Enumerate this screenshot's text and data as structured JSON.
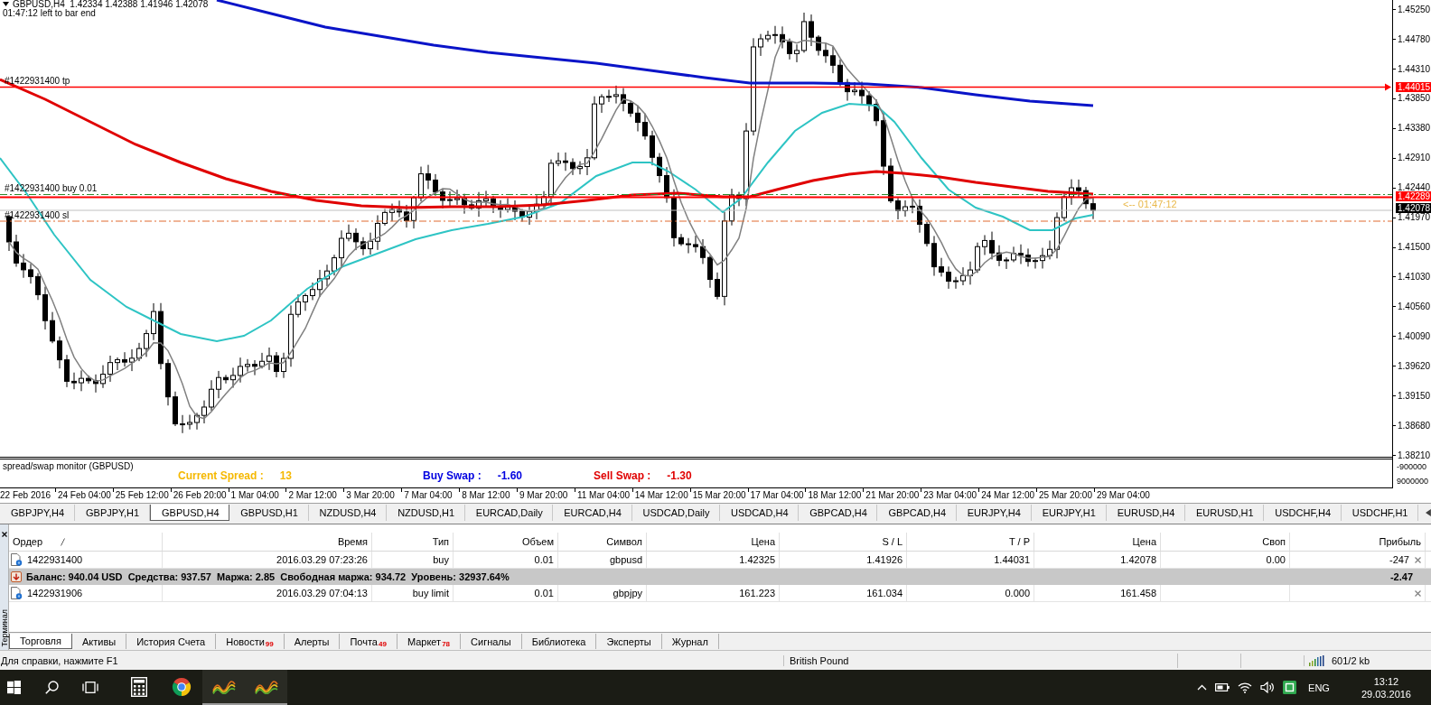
{
  "chart": {
    "info": "GBPUSD,H4  1.42334 1.42388 1.41946 1.42078",
    "timer": "01:47:12 left to bar end",
    "countdown": "<-- 01:47:12",
    "lines": [
      {
        "kind": "tp",
        "label": "#1422931400 tp",
        "price": "1.44015"
      },
      {
        "kind": "level",
        "price": "1.42289"
      },
      {
        "kind": "open",
        "label": "#1422931400 buy 0.01"
      },
      {
        "kind": "bid",
        "price": "1.42078"
      },
      {
        "kind": "sl",
        "label": "#1422931400 sl"
      }
    ],
    "price_axis": [
      "1.45250",
      "1.44780",
      "1.44310",
      "1.43850",
      "1.43380",
      "1.42910",
      "1.42440",
      "1.41970",
      "1.41500",
      "1.41030",
      "1.40560",
      "1.40090",
      "1.39620",
      "1.39150",
      "1.38680",
      "1.38210"
    ],
    "time_axis": [
      "22 Feb 2016",
      "24 Feb 04:00",
      "25 Feb 12:00",
      "26 Feb 20:00",
      "1 Mar 04:00",
      "2 Mar 12:00",
      "3 Mar 20:00",
      "7 Mar 04:00",
      "8 Mar 12:00",
      "9 Mar 20:00",
      "11 Mar 04:00",
      "14 Mar 12:00",
      "15 Mar 20:00",
      "17 Mar 04:00",
      "18 Mar 12:00",
      "21 Mar 20:00",
      "23 Mar 04:00",
      "24 Mar 12:00",
      "25 Mar 20:00",
      "29 Mar 04:00"
    ]
  },
  "indicator": {
    "title": "spread/swap monitor (GBPUSD)",
    "items": [
      {
        "label": "Current Spread :",
        "value": "13",
        "color": "#f5b800"
      },
      {
        "label": "Buy Swap :",
        "value": "-1.60",
        "color": "#0000e0"
      },
      {
        "label": "Sell Swap :",
        "value": "-1.30",
        "color": "#e00000"
      }
    ],
    "axis": [
      "-900000",
      "9000000"
    ]
  },
  "chart_tabs": [
    {
      "label": "GBPJPY,H4",
      "selected": false
    },
    {
      "label": "GBPJPY,H1",
      "selected": false
    },
    {
      "label": "GBPUSD,H4",
      "selected": true
    },
    {
      "label": "GBPUSD,H1",
      "selected": false
    },
    {
      "label": "NZDUSD,H4",
      "selected": false
    },
    {
      "label": "NZDUSD,H1",
      "selected": false
    },
    {
      "label": "EURCAD,Daily",
      "selected": false
    },
    {
      "label": "EURCAD,H4",
      "selected": false
    },
    {
      "label": "USDCAD,Daily",
      "selected": false
    },
    {
      "label": "USDCAD,H4",
      "selected": false
    },
    {
      "label": "GBPCAD,H4",
      "selected": false
    },
    {
      "label": "GBPCAD,H4",
      "selected": false
    },
    {
      "label": "EURJPY,H4",
      "selected": false
    },
    {
      "label": "EURJPY,H1",
      "selected": false
    },
    {
      "label": "EURUSD,H4",
      "selected": false
    },
    {
      "label": "EURUSD,H1",
      "selected": false
    },
    {
      "label": "USDCHF,H4",
      "selected": false
    },
    {
      "label": "USDCHF,H1",
      "selected": false
    }
  ],
  "table": {
    "columns": [
      {
        "label": "Ордер",
        "sorted": true
      },
      {
        "label": "Время",
        "sorted": false
      },
      {
        "label": "Тип",
        "sorted": false
      },
      {
        "label": "Объем",
        "sorted": false
      },
      {
        "label": "Символ",
        "sorted": false
      },
      {
        "label": "Цена",
        "sorted": false
      },
      {
        "label": "S / L",
        "sorted": false
      },
      {
        "label": "T / P",
        "sorted": false
      },
      {
        "label": "Цена",
        "sorted": false
      },
      {
        "label": "Своп",
        "sorted": false
      },
      {
        "label": "Прибыль",
        "sorted": false
      }
    ],
    "rows": [
      {
        "kind": "order",
        "cells": [
          "1422931400",
          "2016.03.29 07:23:26",
          "buy",
          "0.01",
          "gbpusd",
          "1.42325",
          "1.41926",
          "1.44031",
          "1.42078",
          "0.00",
          "-247"
        ]
      },
      {
        "kind": "summary",
        "text": "Баланс: 940.04 USD  Средства: 937.57  Маржа: 2.85  Свободная маржа: 934.72  Уровень: 32937.64%",
        "total": "-2.47"
      },
      {
        "kind": "order",
        "cells": [
          "1422931906",
          "2016.03.29 07:04:13",
          "buy limit",
          "0.01",
          "gbpjpy",
          "161.223",
          "161.034",
          "0.000",
          "161.458",
          null,
          null
        ]
      }
    ]
  },
  "terminal": {
    "title": "Терминал",
    "tabs": [
      {
        "label": "Торговля",
        "selected": true
      },
      {
        "label": "Активы",
        "selected": false
      },
      {
        "label": "История Счета",
        "selected": false
      },
      {
        "label": "Новости",
        "count": "99",
        "selected": false
      },
      {
        "label": "Алерты",
        "selected": false
      },
      {
        "label": "Почта",
        "count": "49",
        "selected": false
      },
      {
        "label": "Маркет",
        "count": "78",
        "selected": false
      },
      {
        "label": "Сигналы",
        "selected": false
      },
      {
        "label": "Библиотека",
        "selected": false
      },
      {
        "label": "Эксперты",
        "selected": false
      },
      {
        "label": "Журнал",
        "selected": false
      }
    ]
  },
  "status_bar": {
    "hint": "Для справки, нажмите F1",
    "symbol": "British Pound",
    "traffic": "601/2 kb"
  },
  "taskbar": {
    "apps": [
      {
        "kind": "calculator",
        "running": false
      },
      {
        "kind": "browser",
        "running": false
      },
      {
        "kind": "wave",
        "running": true
      },
      {
        "kind": "wave",
        "running": true
      }
    ],
    "language": "ENG",
    "time": "13:12",
    "date": "29.03.2016"
  }
}
